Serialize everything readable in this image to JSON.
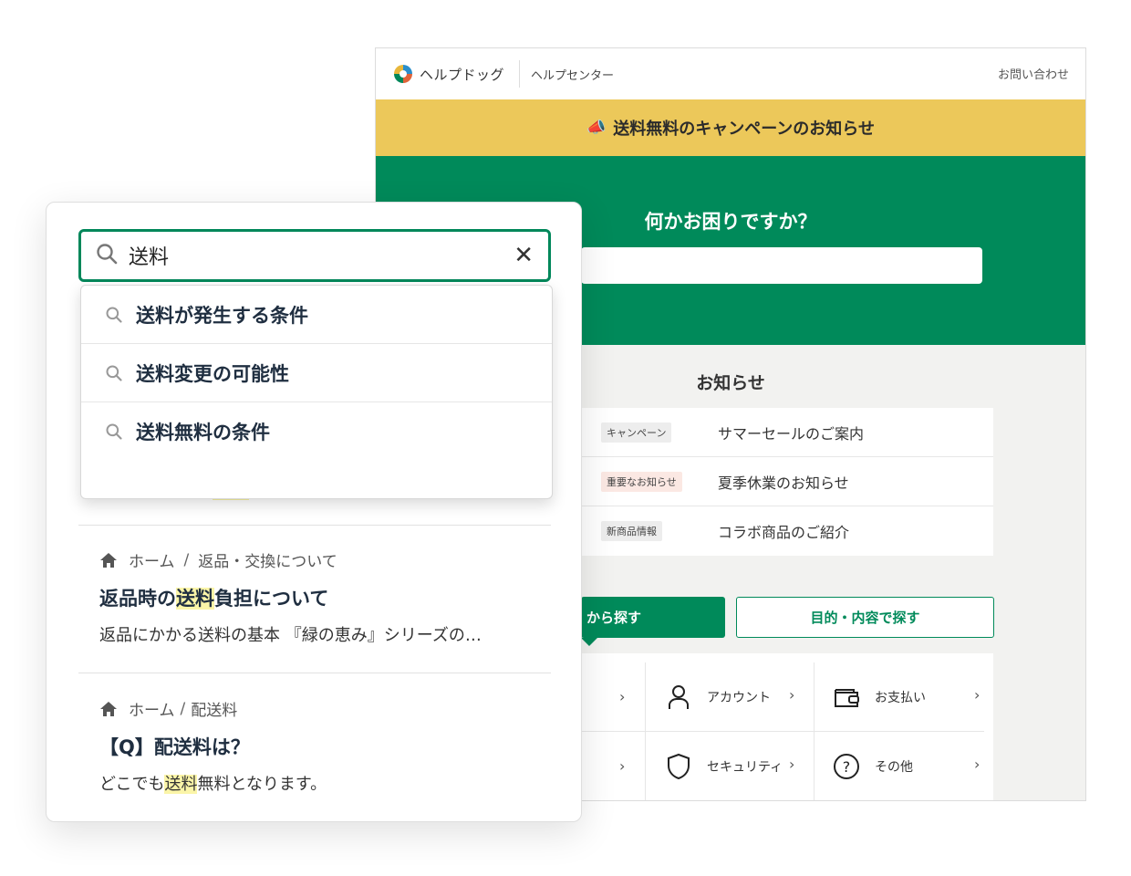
{
  "help_center": {
    "brand": "ヘルプドッグ",
    "subtitle": "ヘルプセンター",
    "contact": "お問い合わせ",
    "banner": "送料無料のキャンペーンのお知らせ",
    "hero_title": "何かお困りですか？",
    "news_title": "お知らせ",
    "news": [
      {
        "badge": "キャンペーン",
        "text": "サマーセールのご案内"
      },
      {
        "badge": "重要なお知らせ",
        "text": "夏季休業のお知らせ"
      },
      {
        "badge": "新商品情報",
        "text": "コラボ商品のご紹介"
      }
    ],
    "tab_active_partial": "から探す",
    "tab_purpose": "目的・内容で探す",
    "categories": [
      {
        "label": "アカウント",
        "icon": "person-icon"
      },
      {
        "label": "お支払い",
        "icon": "wallet-icon"
      },
      {
        "label": "セキュリティ",
        "icon": "shield-icon"
      },
      {
        "label": "その他",
        "icon": "question-icon"
      }
    ]
  },
  "search": {
    "query": "送料",
    "suggestions": [
      "送料が発生する条件",
      "送料変更の可能性",
      "送料無料の条件"
    ],
    "results": [
      {
        "crumb_home": "ホーム",
        "crumb_section": "返品・交換について",
        "title_pre": "返品時の",
        "title_mark": "送料",
        "title_post": "負担について",
        "snippet": "返品にかかる送料の基本 『緑の恵み』シリーズの…"
      },
      {
        "crumb_home": "ホーム",
        "crumb_section": "配送料",
        "title": "【Q】配送料は？",
        "snippet_pre": "どこでも",
        "snippet_mark": "送料",
        "snippet_post": "無料となります。"
      }
    ]
  },
  "colors": {
    "brand_green": "#008a5a",
    "banner_yellow": "#ecc85a",
    "highlight": "#fbf5a8"
  }
}
